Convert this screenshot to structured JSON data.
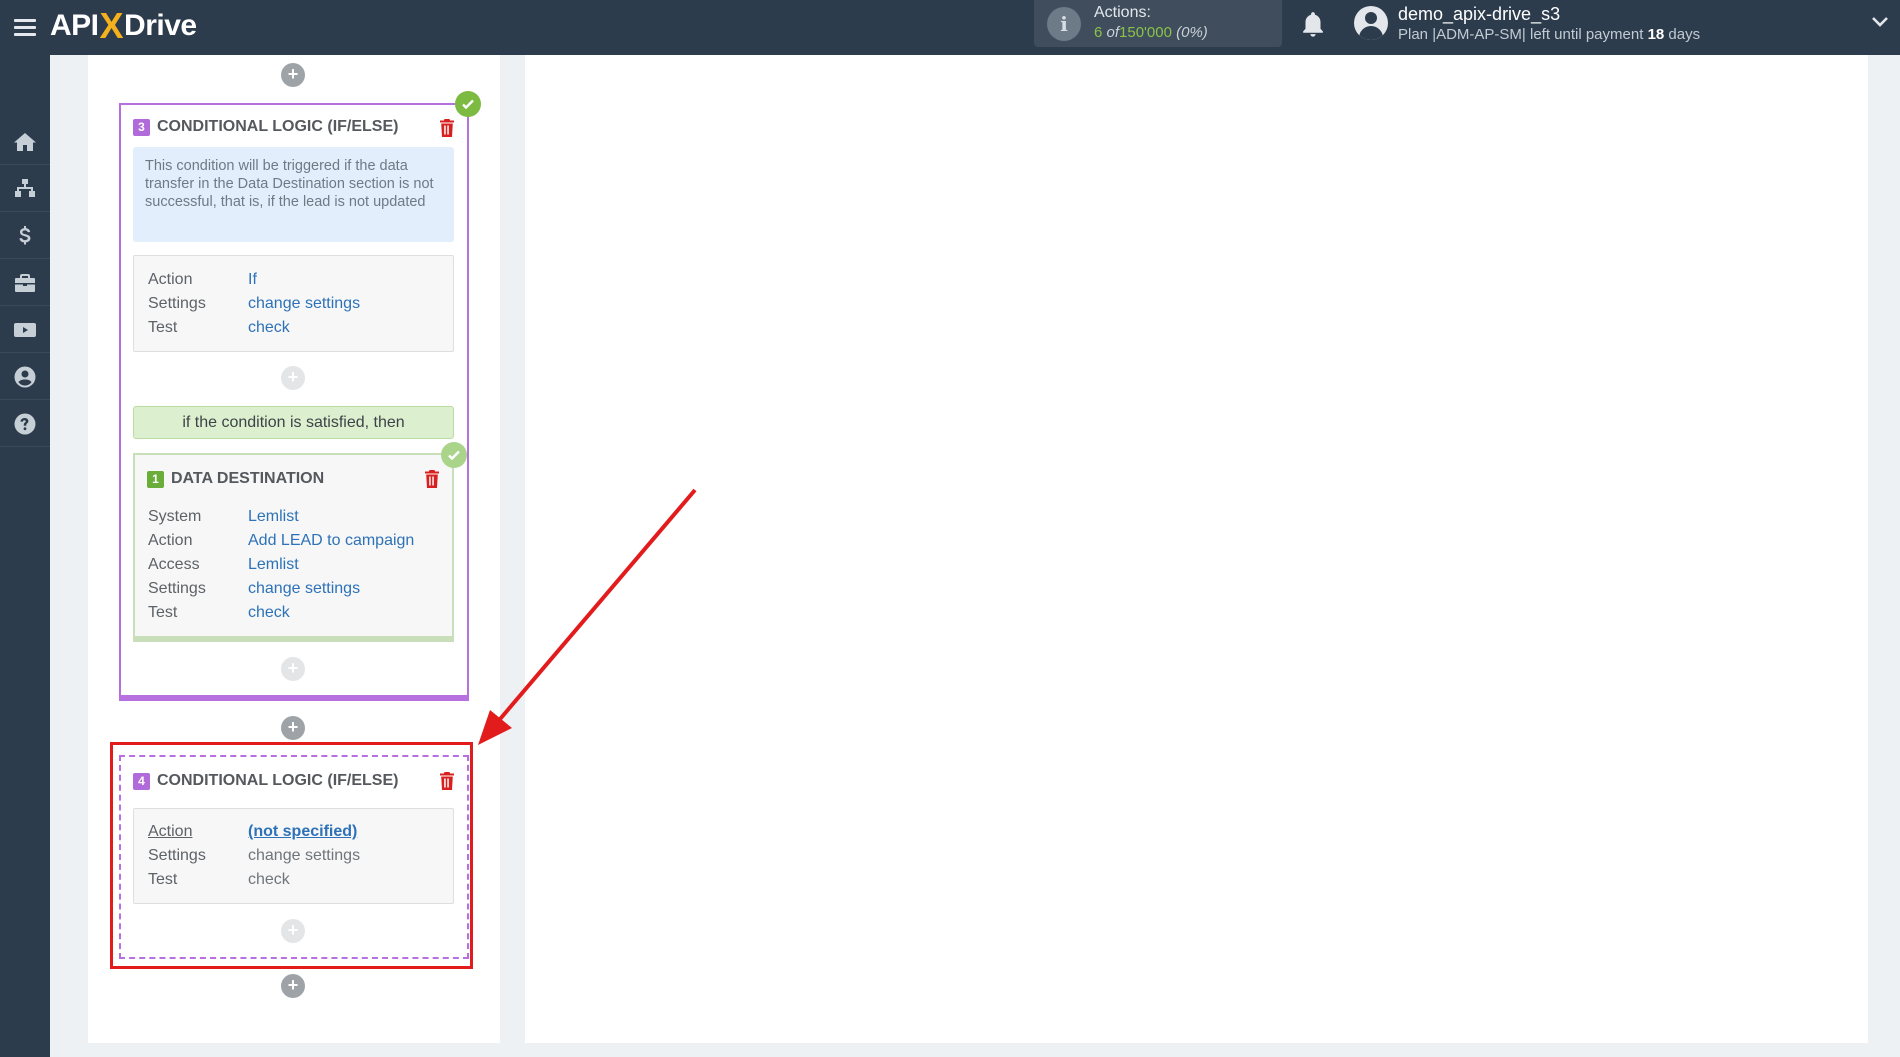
{
  "header": {
    "logo": {
      "part1": "API",
      "part2": "X",
      "part3": "Drive"
    },
    "actions": {
      "title": "Actions:",
      "used": "6",
      "of": "of",
      "total": "150'000",
      "percent": "(0%)"
    },
    "user": {
      "name": "demo_apix-drive_s3",
      "plan_prefix": "Plan |ADM-AP-SM| left until payment",
      "days_number": "18",
      "days_suffix": "days"
    }
  },
  "sidebar": {
    "items": [
      {
        "icon": "home-icon"
      },
      {
        "icon": "sitemap-icon"
      },
      {
        "icon": "dollar-icon"
      },
      {
        "icon": "briefcase-icon"
      },
      {
        "icon": "youtube-icon"
      },
      {
        "icon": "user-circle-icon"
      },
      {
        "icon": "help-icon"
      }
    ]
  },
  "block3": {
    "number": "3",
    "title": "CONDITIONAL LOGIC (IF/ELSE)",
    "note": "This condition will be triggered if the data transfer in the Data Destination section is not successful, that is, if the lead is not updated",
    "rows": [
      {
        "key": "Action",
        "value": "If"
      },
      {
        "key": "Settings",
        "value": "change settings"
      },
      {
        "key": "Test",
        "value": "check"
      }
    ],
    "condition_text": "if the condition is satisfied, then",
    "destination": {
      "number": "1",
      "title": "DATA DESTINATION",
      "rows": [
        {
          "key": "System",
          "value": "Lemlist"
        },
        {
          "key": "Action",
          "value": "Add LEAD to campaign"
        },
        {
          "key": "Access",
          "value": "Lemlist"
        },
        {
          "key": "Settings",
          "value": "change settings"
        },
        {
          "key": "Test",
          "value": "check"
        }
      ]
    }
  },
  "block4": {
    "number": "4",
    "title": "CONDITIONAL LOGIC (IF/ELSE)",
    "rows": [
      {
        "key": "Action",
        "value": "(not specified)"
      },
      {
        "key": "Settings",
        "value": "change settings"
      },
      {
        "key": "Test",
        "value": "check"
      }
    ]
  },
  "plus_label": "+",
  "colors": {
    "topbar": "#2d3c4d",
    "accent_purple": "#b86fe0",
    "accent_green": "#7cba41",
    "highlight_red": "#e21c1c",
    "link_blue": "#2d72b8"
  }
}
